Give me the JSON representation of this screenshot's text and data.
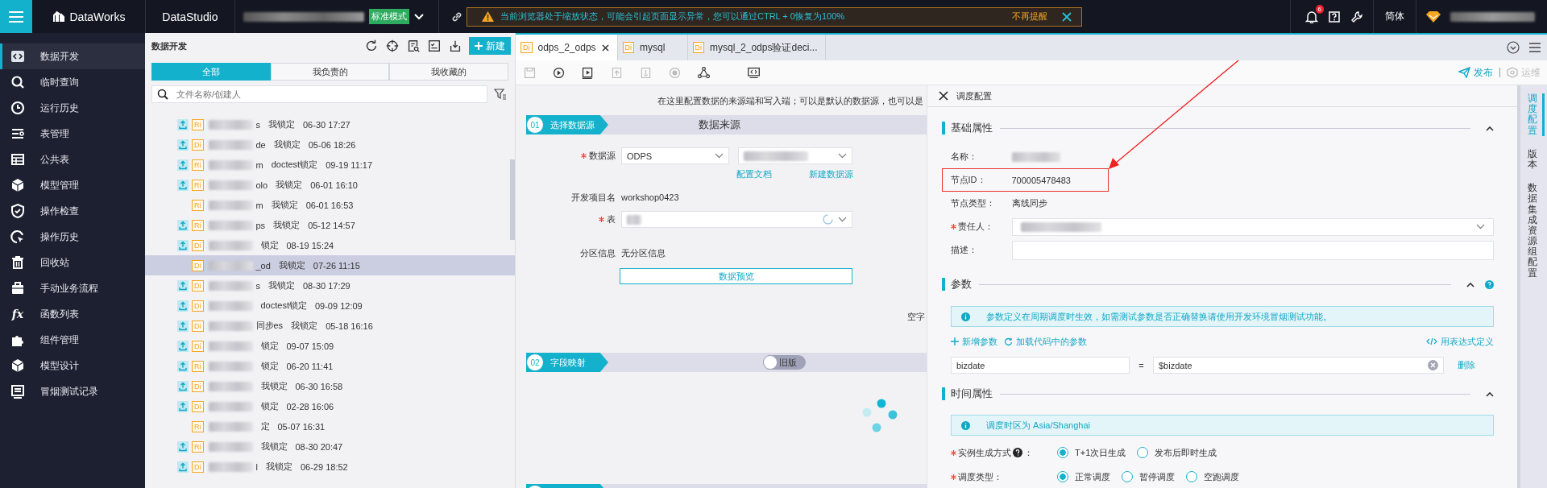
{
  "top_bar": {
    "logo": "DataWorks",
    "module": "DataStudio",
    "mode_badge": "标准模式",
    "warning": {
      "text": "当前浏览器处于缩放状态，可能会引起页面显示异常，您可以通过CTRL + 0恢复为100%",
      "dismiss": "不再提醒"
    },
    "notification_count": "6",
    "language": "简体"
  },
  "sidebar": {
    "items": [
      {
        "label": "数据开发",
        "selected": true
      },
      {
        "label": "临时查询",
        "selected": false
      },
      {
        "label": "运行历史",
        "selected": false
      },
      {
        "label": "表管理",
        "selected": false
      },
      {
        "label": "公共表",
        "selected": false
      },
      {
        "label": "模型管理",
        "selected": false
      },
      {
        "label": "操作检查",
        "selected": false
      },
      {
        "label": "操作历史",
        "selected": false
      },
      {
        "label": "回收站",
        "selected": false
      },
      {
        "label": "手动业务流程",
        "selected": false
      },
      {
        "label": "函数列表",
        "selected": false,
        "glyph": "fx"
      },
      {
        "label": "组件管理",
        "selected": false
      },
      {
        "label": "模型设计",
        "selected": false
      },
      {
        "label": "冒烟测试记录",
        "selected": false
      }
    ]
  },
  "file_panel": {
    "title": "数据开发",
    "new_button": "新建",
    "tabs": [
      {
        "label": "全部",
        "selected": true
      },
      {
        "label": "我负责的",
        "selected": false
      },
      {
        "label": "我收藏的",
        "selected": false
      }
    ],
    "search": {
      "placeholder": "文件名称/创建人"
    },
    "files": [
      {
        "type": "Ri",
        "submitted": true,
        "name": "s",
        "owner": "我锁定",
        "time": "06-30 17:27",
        "selected": false
      },
      {
        "type": "Di",
        "submitted": true,
        "name": "de",
        "owner": "我锁定",
        "time": "05-06 18:26",
        "selected": false
      },
      {
        "type": "Ri",
        "submitted": true,
        "name": "m",
        "owner": "doctest锁定",
        "time": "09-19 11:17",
        "selected": false
      },
      {
        "type": "Ri",
        "submitted": true,
        "name": "olo",
        "owner": "我锁定",
        "time": "06-01 16:10",
        "selected": false
      },
      {
        "type": "Ri",
        "submitted": false,
        "name": "m",
        "owner": "我锁定",
        "time": "06-01 16:53",
        "selected": false
      },
      {
        "type": "Ri",
        "submitted": true,
        "name": "ps",
        "owner": "我锁定",
        "time": "05-12 14:57",
        "selected": false
      },
      {
        "type": "Di",
        "submitted": true,
        "owner": "锁定",
        "time": "08-19 15:24",
        "selected": false
      },
      {
        "type": "Di",
        "submitted": false,
        "name": "_od",
        "owner": "我锁定",
        "time": "07-26 11:15",
        "selected": true
      },
      {
        "type": "Di",
        "submitted": true,
        "name": "s",
        "owner": "我锁定",
        "time": "08-30 17:29",
        "selected": false
      },
      {
        "type": "Di",
        "submitted": true,
        "owner": "doctest锁定",
        "time": "09-09 12:09",
        "selected": false
      },
      {
        "type": "Di",
        "submitted": true,
        "name": "同步es",
        "owner": "我锁定",
        "time": "05-18 16:16",
        "selected": false
      },
      {
        "type": "Di",
        "submitted": true,
        "owner": "锁定",
        "time": "09-07 15:09",
        "selected": false
      },
      {
        "type": "Ri",
        "submitted": true,
        "owner": "锁定",
        "time": "06-20 11:41",
        "selected": false
      },
      {
        "type": "Di",
        "submitted": true,
        "owner": "我锁定",
        "time": "06-30 16:58",
        "selected": false
      },
      {
        "type": "Di",
        "submitted": true,
        "owner": "锁定",
        "time": "02-28 16:06",
        "selected": false
      },
      {
        "type": "Ri",
        "submitted": false,
        "owner": "定",
        "time": "05-07 16:31",
        "selected": false
      },
      {
        "type": "Ri",
        "submitted": true,
        "owner": "我锁定",
        "time": "08-30 20:47",
        "selected": false
      },
      {
        "type": "Di",
        "submitted": true,
        "name": "l",
        "owner": "我锁定",
        "time": "06-29 18:52",
        "selected": false
      }
    ]
  },
  "editor": {
    "tabs": [
      {
        "type": "Di",
        "label": "odps_2_odps",
        "selected": true
      },
      {
        "type": "Di",
        "label": "mysql",
        "selected": false
      },
      {
        "type": "Di",
        "label": "mysql_2_odps验证deci...",
        "selected": false
      }
    ],
    "toolbar": {
      "publish": "发布",
      "ops": {
        "label": "运维",
        "disabled": true
      }
    },
    "hint": "在这里配置数据的来源端和写入端；可以是默认的数据源，也可以是",
    "source_step": {
      "number": "01",
      "label": "选择数据源",
      "title": "数据来源"
    },
    "source_form": {
      "datasource_label": "数据源",
      "datasource_type": "ODPS",
      "links": [
        "配置文档",
        "新建数据源"
      ],
      "project_label": "开发项目名",
      "project_value": "workshop0423",
      "table_label": "表",
      "partition_label": "分区信息",
      "partition_value": "无分区信息",
      "preview_button": "数据预览",
      "cut_label": "空字"
    },
    "mapping_step": {
      "number": "02",
      "label": "字段映射",
      "toggle": {
        "label": "旧版",
        "on": false
      }
    }
  },
  "schedule": {
    "title": "调度配置",
    "basic": {
      "title": "基础属性",
      "fields": [
        {
          "label": "名称：",
          "kind": "blurred",
          "highlighted": false
        },
        {
          "label": "节点ID：",
          "kind": "text",
          "value": "700005478483",
          "highlighted": true
        },
        {
          "label": "节点类型：",
          "kind": "text",
          "value": "离线同步",
          "highlighted": false
        },
        {
          "label": "责任人：",
          "kind": "select",
          "required": true,
          "highlighted": false
        },
        {
          "label": "描述：",
          "kind": "input",
          "highlighted": false
        }
      ]
    },
    "params": {
      "title": "参数",
      "info": "参数定义在周期调度时生效，如需测试参数是否正确替换请使用开发环境冒烟测试功能。",
      "actions": [
        "新增参数",
        "加载代码中的参数"
      ],
      "expression_link": "用表达式定义",
      "rows": [
        {
          "name": "bizdate",
          "operator": "=",
          "value": "$bizdate",
          "delete": "删除"
        }
      ]
    },
    "time": {
      "title": "时间属性",
      "info": "调度时区为 Asia/Shanghai",
      "options": [
        {
          "label": "实例生成方式",
          "help": true,
          "suffix": "：",
          "required": true,
          "choices": [
            {
              "label": "T+1次日生成",
              "selected": true
            },
            {
              "label": "发布后即时生成",
              "selected": false
            }
          ]
        },
        {
          "label": "调度类型：",
          "required": true,
          "choices": [
            {
              "label": "正常调度",
              "selected": true
            },
            {
              "label": "暂停调度",
              "selected": false
            },
            {
              "label": "空跑调度",
              "selected": false
            }
          ]
        }
      ]
    }
  },
  "side_tabs": [
    {
      "label": "调度配置",
      "selected": true
    },
    {
      "label": "版本",
      "selected": false
    },
    {
      "label": "数据集成资源组配置",
      "selected": false
    }
  ]
}
